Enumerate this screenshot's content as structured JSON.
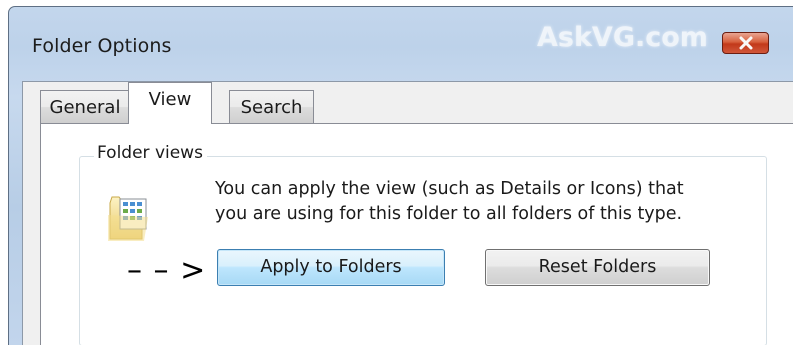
{
  "window": {
    "title": "Folder Options",
    "watermark": "AskVG.com",
    "close_icon": "close-icon"
  },
  "tabs": [
    {
      "label": "General",
      "selected": false
    },
    {
      "label": "View",
      "selected": true
    },
    {
      "label": "Search",
      "selected": false
    }
  ],
  "folder_views": {
    "group_label": "Folder views",
    "description_line1": "You can apply the view (such as Details or Icons) that",
    "description_line2": "you are using for this folder to all folders of this type.",
    "icon": "folder-view-icon",
    "annotation_arrow": "– – >",
    "apply_button_label": "Apply to Folders",
    "reset_button_label": "Reset Folders"
  },
  "colors": {
    "close_button": "#c94a2b",
    "apply_button_border": "#3c7fb1",
    "frame": "#bdd2ea"
  }
}
